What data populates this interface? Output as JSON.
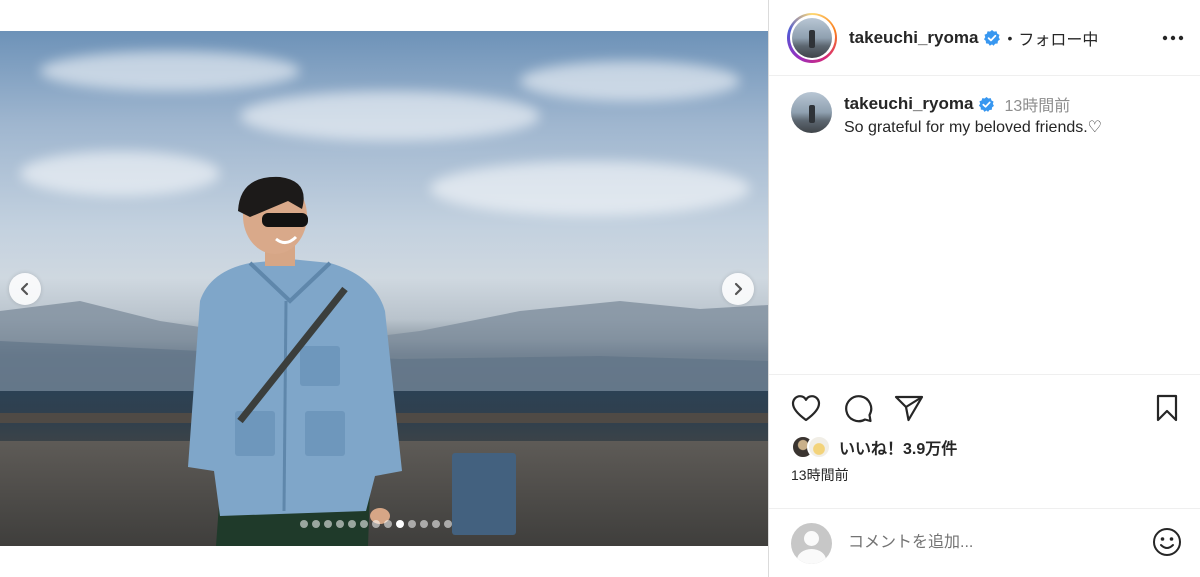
{
  "post": {
    "image_count": 13,
    "active_image_index": 9
  },
  "header": {
    "username": "takeuchi_ryoma",
    "separator": "•",
    "follow_status": "フォロー中"
  },
  "caption": {
    "username": "takeuchi_ryoma",
    "time": "13時間前",
    "text": "So grateful for my beloved friends.♡"
  },
  "engagement": {
    "likes_label": "いいね！3.9万件",
    "time": "13時間前"
  },
  "comment_box": {
    "placeholder": "コメントを追加..."
  },
  "icons": {
    "prev": "chevron-left-icon",
    "next": "chevron-right-icon",
    "verified": "verified-badge-icon",
    "more": "more-options-icon",
    "like": "heart-icon",
    "comment": "comment-bubble-icon",
    "share": "paper-plane-icon",
    "save": "bookmark-icon",
    "emoji": "smiley-icon"
  },
  "colors": {
    "verified_blue": "#3897f0",
    "text_primary": "#262626",
    "text_secondary": "#8e8e8e"
  }
}
